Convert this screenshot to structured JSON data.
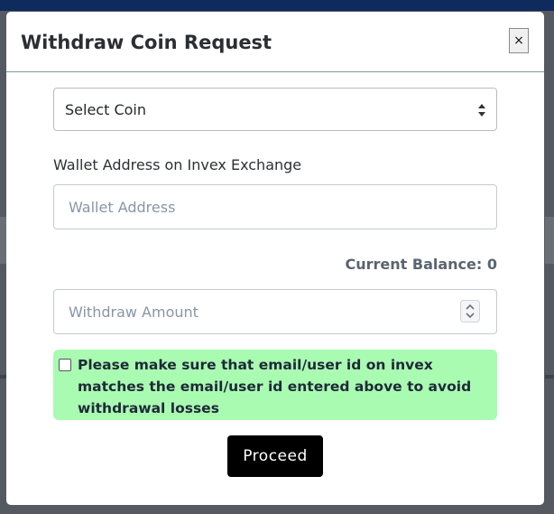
{
  "modal": {
    "title": "Withdraw Coin Request",
    "close_label": "×"
  },
  "coin_select": {
    "selected": "Select Coin",
    "icon": "updown-arrows-icon"
  },
  "wallet": {
    "label": "Wallet Address on Invex Exchange",
    "placeholder": "Wallet Address",
    "value": ""
  },
  "balance": {
    "text": "Current Balance: 0"
  },
  "amount": {
    "placeholder": "Withdraw Amount",
    "value": ""
  },
  "notice": {
    "checked": false,
    "text": "Please make sure that email/user id on invex matches the email/user id entered above to avoid withdrawal losses"
  },
  "actions": {
    "proceed_label": "Proceed"
  },
  "colors": {
    "notice_bg": "#a9fbb2",
    "button_bg": "#000000",
    "backdrop": "#555a62"
  }
}
